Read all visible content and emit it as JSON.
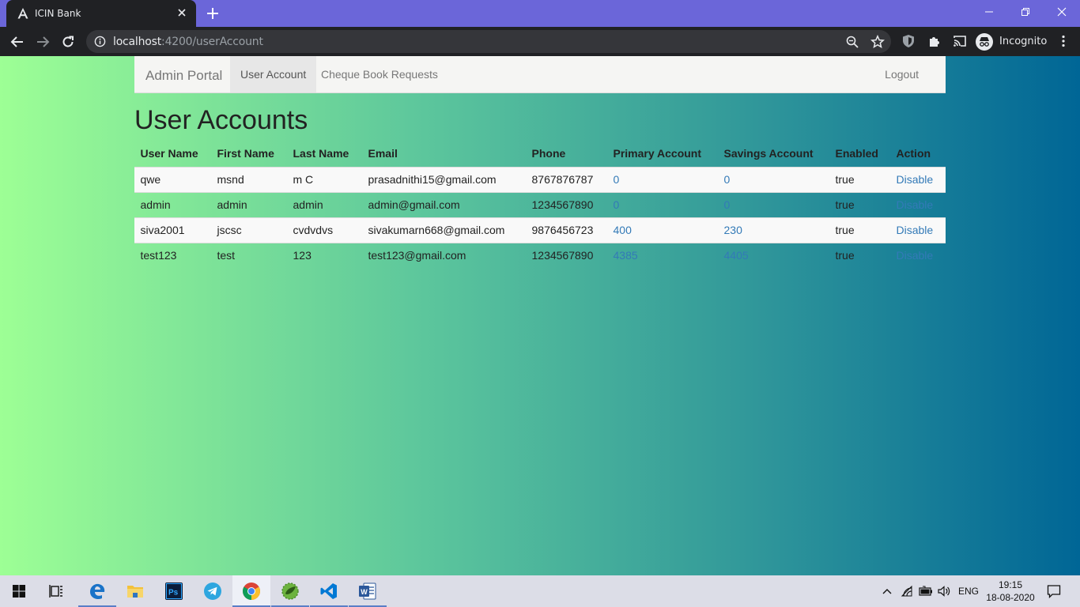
{
  "browser": {
    "tab_title": "ICIN Bank",
    "url_host": "localhost",
    "url_rest": ":4200/userAccount",
    "profile_label": "Incognito"
  },
  "navbar": {
    "brand": "Admin Portal",
    "links": [
      "User Account",
      "Cheque Book Requests"
    ],
    "active": "User Account",
    "logout": "Logout"
  },
  "page": {
    "heading": "User Accounts"
  },
  "table": {
    "columns": [
      "User Name",
      "First Name",
      "Last Name",
      "Email",
      "Phone",
      "Primary Account",
      "Savings Account",
      "Enabled",
      "Action"
    ],
    "rows": [
      {
        "username": "qwe",
        "first": "msnd",
        "last": "m C",
        "email": "prasadnithi15@gmail.com",
        "phone": "8767876787",
        "primary": "0",
        "savings": "0",
        "enabled": "true",
        "action": "Disable"
      },
      {
        "username": "admin",
        "first": "admin",
        "last": "admin",
        "email": "admin@gmail.com",
        "phone": "1234567890",
        "primary": "0",
        "savings": "0",
        "enabled": "true",
        "action": "Disable"
      },
      {
        "username": "siva2001",
        "first": "jscsc",
        "last": "cvdvdvs",
        "email": "sivakumarn668@gmail.com",
        "phone": "9876456723",
        "primary": "400",
        "savings": "230",
        "enabled": "true",
        "action": "Disable"
      },
      {
        "username": "test123",
        "first": "test",
        "last": "123",
        "email": "test123@gmail.com",
        "phone": "1234567890",
        "primary": "4385",
        "savings": "4405",
        "enabled": "true",
        "action": "Disable"
      }
    ]
  },
  "taskbar": {
    "language": "ENG",
    "time": "19:15",
    "date": "18-08-2020"
  },
  "colors": {
    "tabstrip": "#6b66d9",
    "link": "#337ab7",
    "gradient_start": "#9dff95",
    "gradient_end": "#006696"
  }
}
